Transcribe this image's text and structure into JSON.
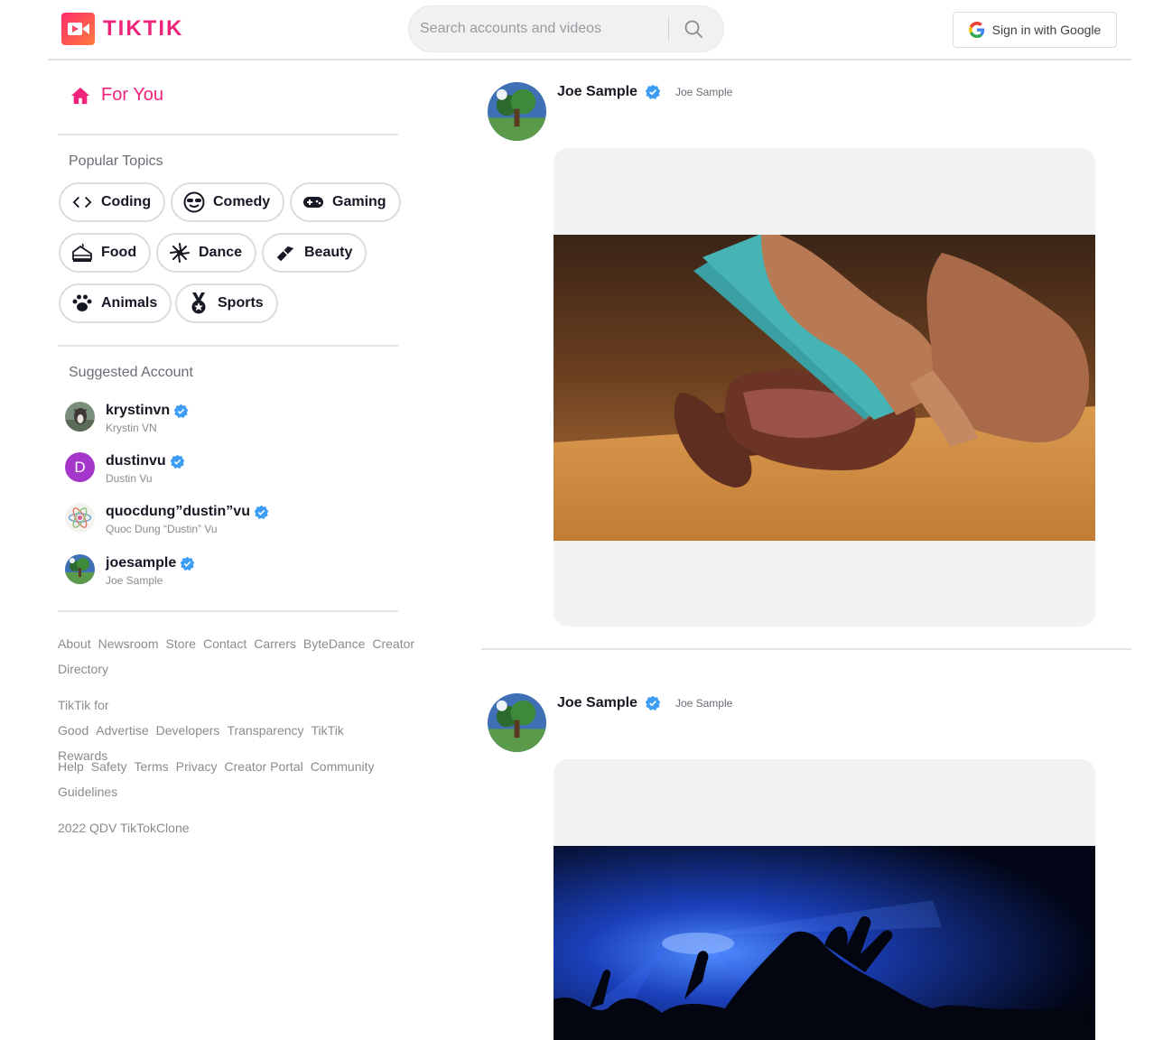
{
  "brand": {
    "name": "TIKTIK",
    "accent": "#f0237b"
  },
  "search": {
    "placeholder": "Search accounts and videos"
  },
  "auth": {
    "google_label": "Sign in with Google"
  },
  "sidebar": {
    "for_you": "For You",
    "topics_title": "Popular Topics",
    "topics": [
      {
        "label": "Coding",
        "icon": "code-icon"
      },
      {
        "label": "Comedy",
        "icon": "sunglasses-face-icon"
      },
      {
        "label": "Gaming",
        "icon": "gamepad-icon"
      },
      {
        "label": "Food",
        "icon": "cake-icon"
      },
      {
        "label": "Dance",
        "icon": "dance-icon"
      },
      {
        "label": "Beauty",
        "icon": "lipstick-icon"
      },
      {
        "label": "Animals",
        "icon": "paw-icon"
      },
      {
        "label": "Sports",
        "icon": "medal-icon"
      }
    ],
    "suggested_title": "Suggested Account",
    "accounts": [
      {
        "user": "krystinvn",
        "full": "Krystin VN"
      },
      {
        "user": "dustinvu",
        "full": "Dustin Vu",
        "initial": "D"
      },
      {
        "user": "quocdung”dustin”vu",
        "full": "Quoc Dung “Dustin” Vu"
      },
      {
        "user": "joesample",
        "full": "Joe Sample"
      }
    ],
    "footer": {
      "links1": [
        "About",
        "Newsroom",
        "Store",
        "Contact",
        "Carrers",
        "ByteDance",
        "Creator Directory"
      ],
      "links2": [
        "TikTik for Good",
        "Advertise",
        "Developers",
        "Transparency",
        "TikTik Rewards"
      ],
      "links3": [
        "Help",
        "Safety",
        "Terms",
        "Privacy",
        "Creator Portal",
        "Community Guidelines"
      ],
      "copyright": "2022 QDV TikTokClone"
    }
  },
  "posts": [
    {
      "user": "Joe Sample",
      "full": "Joe Sample"
    },
    {
      "user": "Joe Sample",
      "full": "Joe Sample"
    }
  ]
}
